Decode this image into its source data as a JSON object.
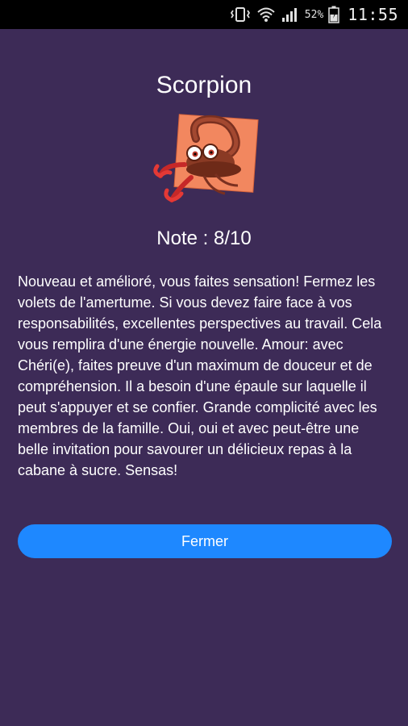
{
  "status_bar": {
    "battery_percent": "52%",
    "time": "11:55",
    "icons": [
      "vibrate-icon",
      "wifi-icon",
      "signal-icon",
      "battery-icon"
    ]
  },
  "dialog": {
    "title": "Scorpion",
    "image_icon": "scorpion-sign-icon",
    "rating": "Note : 8/10",
    "text": "Nouveau et amélioré, vous faites sensation! Fermez les volets de l'amertume. Si vous devez faire face à vos responsabilités, excellentes perspectives au travail. Cela vous remplira d'une énergie nouvelle. Amour: avec Chéri(e), faites preuve d'un maximum de douceur et de compréhension. Il a besoin d'une épaule sur laquelle il peut s'appuyer et se confier. Grande complicité avec les membres de la famille. Oui, oui et avec peut-être une belle invitation pour savourer un délicieux repas à la cabane à sucre. Sensas!",
    "close_label": "Fermer"
  },
  "colors": {
    "background": "#3d2b57",
    "button": "#1e88ff",
    "text": "#ffffff"
  }
}
